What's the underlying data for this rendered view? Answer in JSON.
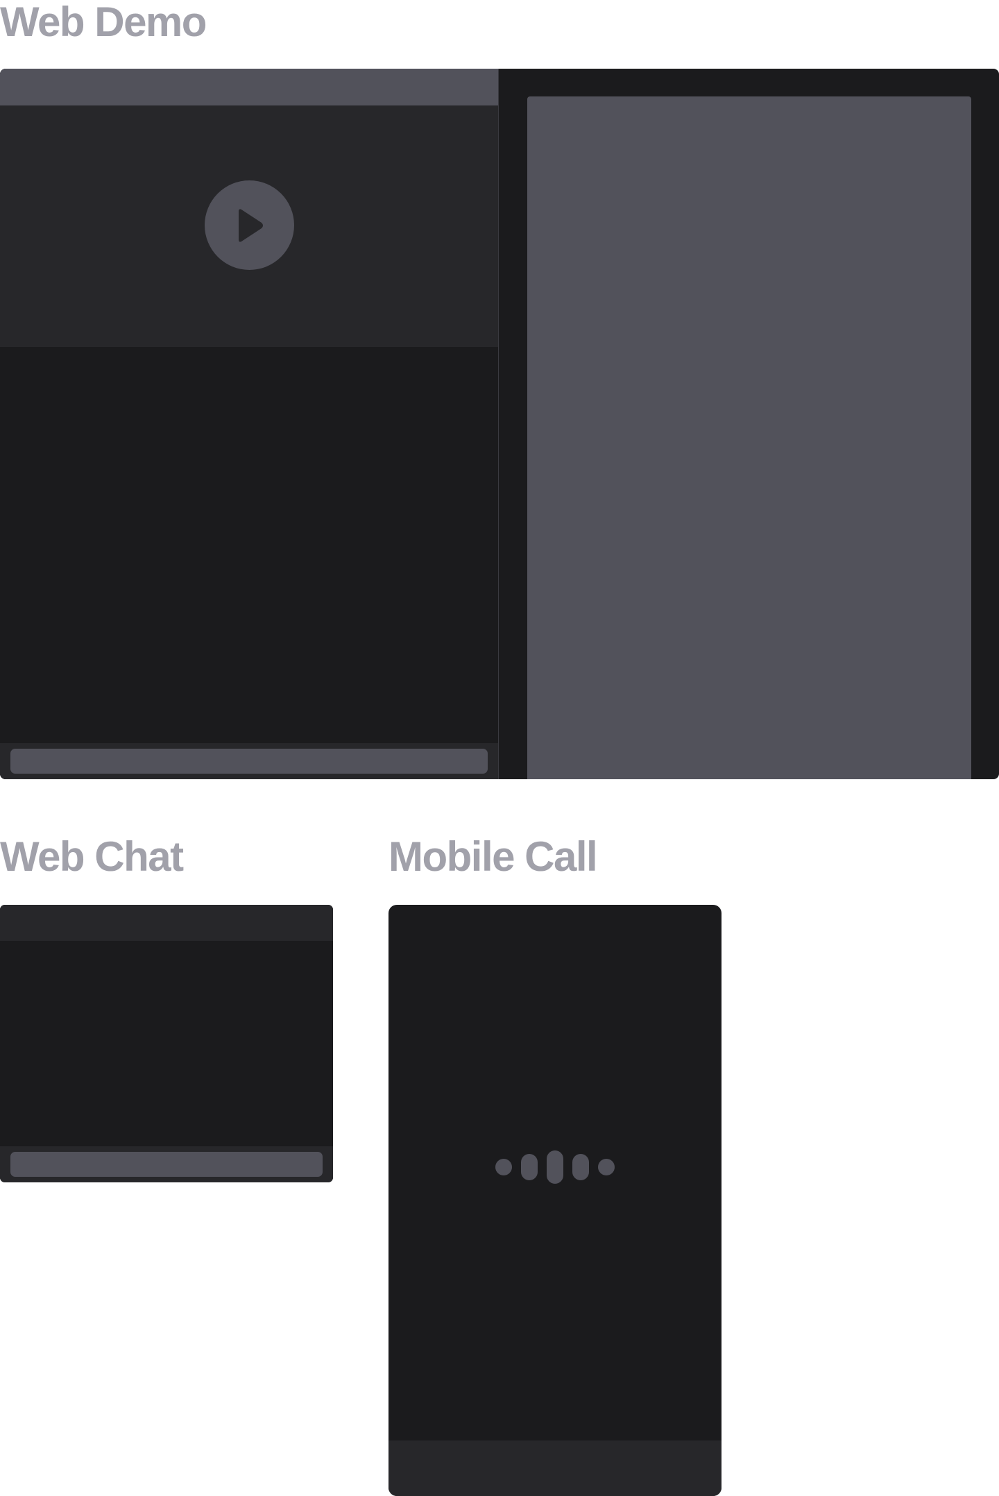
{
  "sections": {
    "web_demo": {
      "title": "Web Demo"
    },
    "web_chat": {
      "title": "Web Chat"
    },
    "mobile_call": {
      "title": "Mobile Call"
    }
  },
  "icons": {
    "play": "play-icon",
    "voice": "voice-wave-icon"
  },
  "colors": {
    "heading": "#a1a1aa",
    "frame_bg": "#1b1b1d",
    "panel_bg": "#27272a",
    "placeholder": "#52525b"
  }
}
